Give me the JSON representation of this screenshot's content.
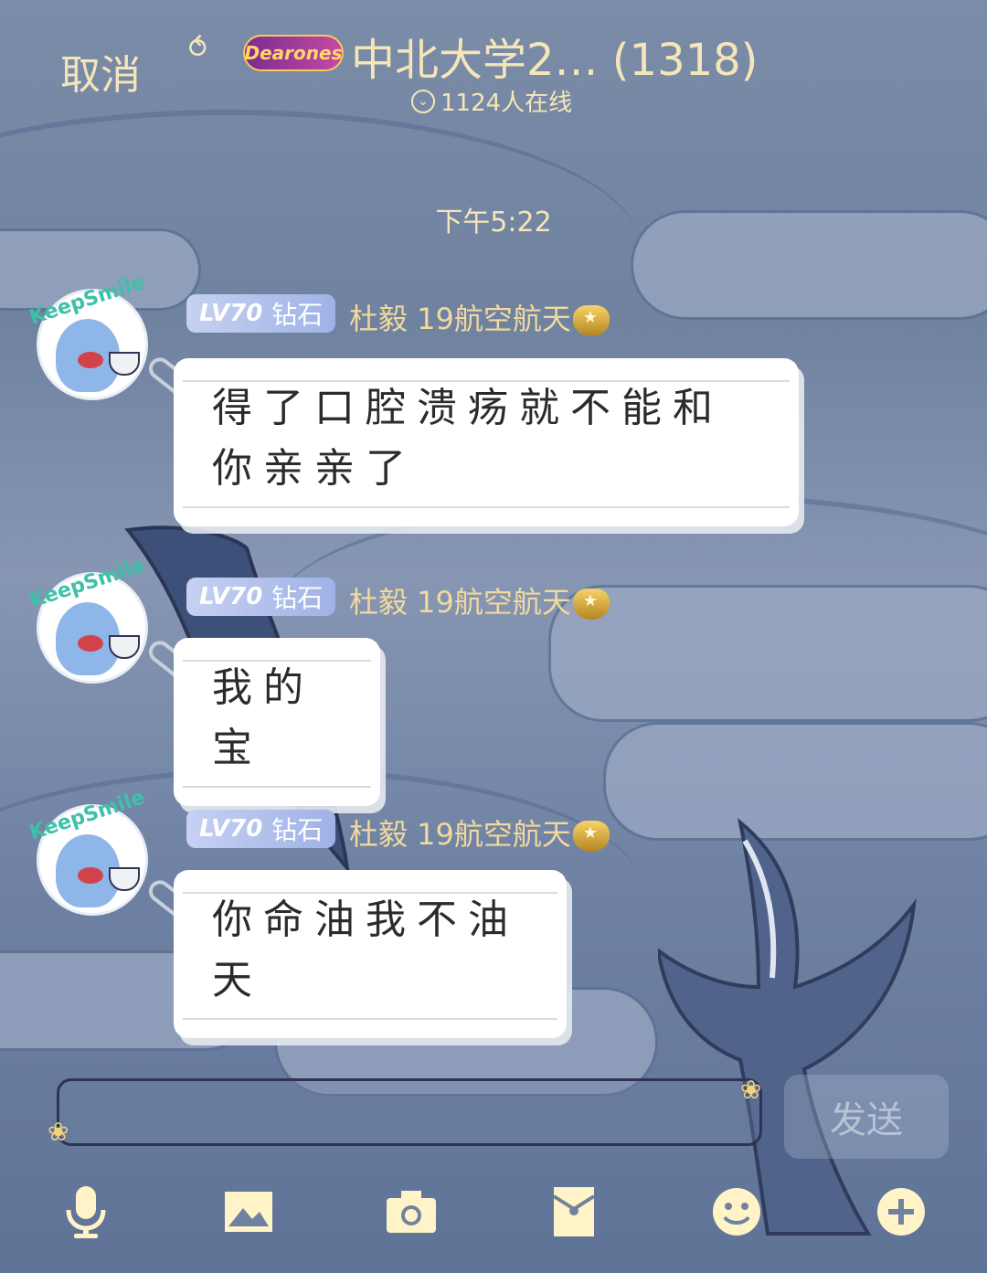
{
  "header": {
    "cancel_label": "取消",
    "badge_text": "Dearones",
    "group_title": "中北大学2… (1318)",
    "online_text": "1124人在线"
  },
  "timestamp": "下午5:22",
  "messages": [
    {
      "avatar_sticker": "KeepSmile",
      "level": "LV70",
      "level_title": "钻石",
      "nickname": "杜毅 19航空航天",
      "text": "得了口腔溃疡就不能和你亲亲了"
    },
    {
      "avatar_sticker": "KeepSmile",
      "level": "LV70",
      "level_title": "钻石",
      "nickname": "杜毅 19航空航天",
      "text": "我的宝"
    },
    {
      "avatar_sticker": "KeepSmile",
      "level": "LV70",
      "level_title": "钻石",
      "nickname": "杜毅 19航空航天",
      "text": "你命油我不油天"
    }
  ],
  "composer": {
    "placeholder": "",
    "send_label": "发送"
  },
  "toolbar": {
    "icons": [
      "microphone-icon",
      "image-icon",
      "camera-icon",
      "red-packet-icon",
      "emoji-icon",
      "plus-icon"
    ]
  },
  "colors": {
    "accent_text": "#f5e6b8",
    "nickname": "#f2d99c",
    "level_badge": "#9fb2e6"
  }
}
